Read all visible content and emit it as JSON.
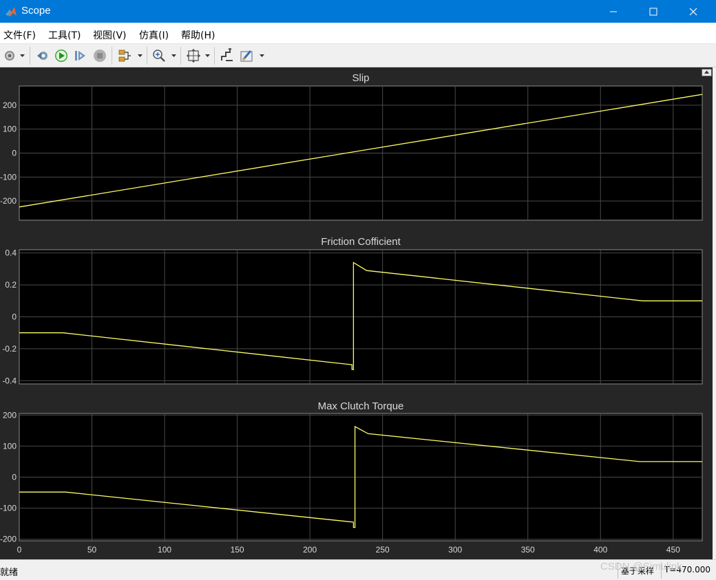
{
  "window": {
    "title": "Scope",
    "minimize_icon": "minimize-icon",
    "maximize_icon": "maximize-icon",
    "close_icon": "close-icon"
  },
  "menu": [
    {
      "label": "文件(F)"
    },
    {
      "label": "工具(T)"
    },
    {
      "label": "视图(V)"
    },
    {
      "label": "仿真(I)"
    },
    {
      "label": "帮助(H)"
    }
  ],
  "toolbar": {
    "items": [
      "settings-icon",
      "step-back-icon",
      "run-icon",
      "step-forward-icon",
      "stop-icon",
      "signal-select-icon",
      "zoom-icon",
      "autoscale-icon",
      "style-icon",
      "measure-icon"
    ]
  },
  "chart_data": [
    {
      "type": "line",
      "title": "Slip",
      "xlim": [
        0,
        470
      ],
      "ylim": [
        -280,
        280
      ],
      "yticks": [
        -200,
        -100,
        0,
        100,
        200
      ],
      "ytick_labels": [
        "-200",
        "-100",
        "0",
        "100",
        "200"
      ],
      "grid": true,
      "series": [
        {
          "color": "#ffff66",
          "x": [
            0,
            470
          ],
          "y": [
            -225,
            245
          ]
        }
      ]
    },
    {
      "type": "line",
      "title": "Friction Cofficient",
      "xlim": [
        0,
        470
      ],
      "ylim": [
        -0.42,
        0.42
      ],
      "yticks": [
        -0.4,
        -0.2,
        0,
        0.2,
        0.4
      ],
      "ytick_labels": [
        "-0.4",
        "-0.2",
        "0",
        "0.2",
        "0.4"
      ],
      "grid": true,
      "series": [
        {
          "color": "#ffff66",
          "x": [
            0,
            30,
            229,
            229,
            230,
            230,
            239,
            429,
            470
          ],
          "y": [
            -0.1,
            -0.1,
            -0.3,
            -0.33,
            -0.33,
            0.34,
            0.29,
            0.1,
            0.1
          ]
        }
      ]
    },
    {
      "type": "line",
      "title": "Max Clutch Torque",
      "xlim": [
        0,
        470
      ],
      "ylim": [
        -205,
        205
      ],
      "yticks": [
        -200,
        -100,
        0,
        100,
        200
      ],
      "ytick_labels": [
        "-200",
        "-100",
        "0",
        "100",
        "200"
      ],
      "grid": true,
      "series": [
        {
          "color": "#ffff66",
          "x": [
            0,
            32,
            230,
            230,
            231,
            231,
            240,
            427,
            470
          ],
          "y": [
            -48,
            -48,
            -145,
            -162,
            -162,
            163,
            140,
            50,
            50
          ]
        }
      ]
    }
  ],
  "xaxis": {
    "ticks": [
      0,
      50,
      100,
      150,
      200,
      250,
      300,
      350,
      400,
      450
    ],
    "tick_labels": [
      "0",
      "50",
      "100",
      "150",
      "200",
      "250",
      "300",
      "350",
      "400",
      "450"
    ]
  },
  "status": {
    "ready": "就绪",
    "sample_mode": "基于采样",
    "time": "T=470.000"
  },
  "watermark": "CSDN @Simulink",
  "colors": {
    "plot_bg": "#000000",
    "figure_bg": "#262626",
    "grid": "#4a4a4a",
    "axis_text": "#d9d9d9",
    "line": "#ffff66",
    "titlebar": "#0078d7"
  }
}
